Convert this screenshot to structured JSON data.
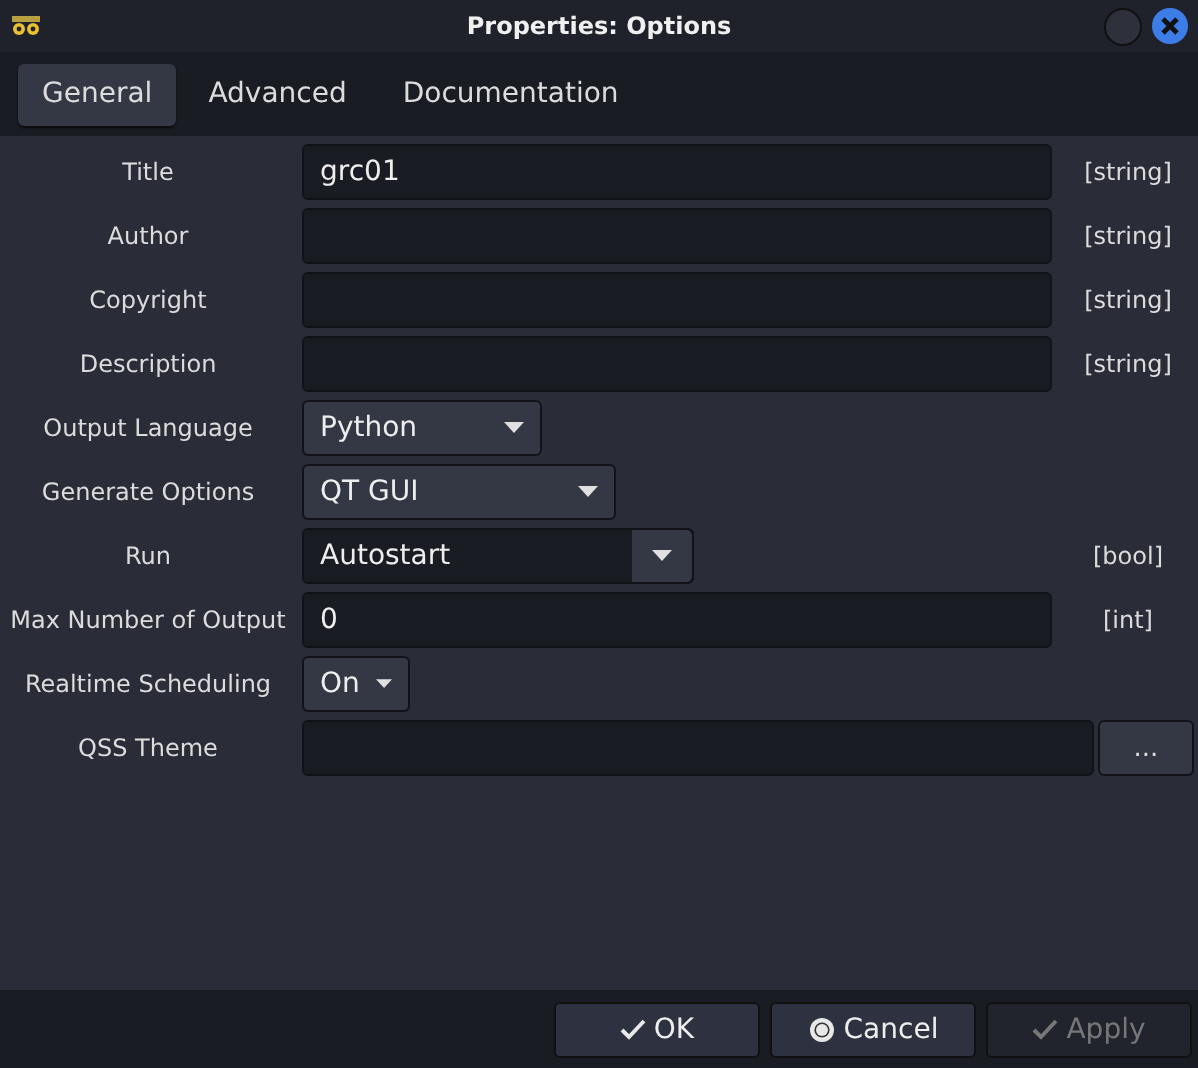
{
  "window": {
    "title": "Properties: Options"
  },
  "tabs": [
    {
      "label": "General",
      "selected": true
    },
    {
      "label": "Advanced",
      "selected": false
    },
    {
      "label": "Documentation",
      "selected": false
    }
  ],
  "fields": [
    {
      "label": "Title",
      "kind": "text",
      "value": "grc01",
      "type": "[string]"
    },
    {
      "label": "Author",
      "kind": "text",
      "type": "[string]"
    },
    {
      "label": "Copyright",
      "kind": "text",
      "type": "[string]"
    },
    {
      "label": "Description",
      "kind": "text",
      "type": "[string]"
    },
    {
      "label": "Output Language",
      "kind": "dropdown",
      "value": "Python"
    },
    {
      "label": "Generate Options",
      "kind": "dropdown",
      "value": "QT GUI"
    },
    {
      "label": "Run",
      "kind": "combo",
      "value": "Autostart",
      "type": "[bool]"
    },
    {
      "label": "Max Number of Output",
      "kind": "text",
      "value": "0",
      "type": "[int]"
    },
    {
      "label": "Realtime Scheduling",
      "kind": "dropdown",
      "value": "On"
    },
    {
      "label": "QSS Theme",
      "kind": "file",
      "button": "..."
    }
  ],
  "buttons": [
    {
      "label": "OK",
      "kind": "confirm",
      "disabled": false
    },
    {
      "label": "Cancel",
      "kind": "cancel",
      "disabled": false
    },
    {
      "label": "Apply",
      "kind": "confirm",
      "disabled": true
    }
  ]
}
